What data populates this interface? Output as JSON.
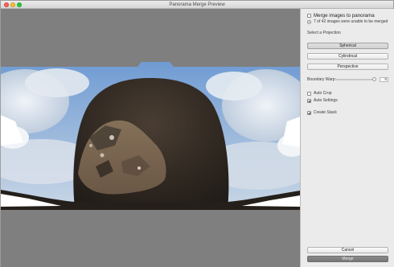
{
  "window": {
    "title": "Panorama Merge Preview"
  },
  "options": {
    "merge_to_panorama": "Merge images to panorama",
    "merge_status": "7 of 42 images were unable to be merged",
    "projection_heading": "Select a Projection",
    "projections": [
      "Spherical",
      "Cylindrical",
      "Perspective"
    ],
    "selected_projection": "Spherical",
    "boundary_warp_label": "Boundary Warp:",
    "boundary_warp_value": "0",
    "boundary_warp_level": 0.9,
    "auto_crop_label": "Auto Crop",
    "auto_settings_label": "Auto Settings",
    "create_stack_label": "Create Stack"
  },
  "footer": {
    "cancel_label": "Cancel",
    "merge_label": "Merge"
  },
  "colors": {
    "sky": "#8fb6e3",
    "cloud": "#e9eef4",
    "rock_dark": "#2f2922",
    "rock_mid": "#54493e",
    "rock_light": "#8e7660"
  }
}
